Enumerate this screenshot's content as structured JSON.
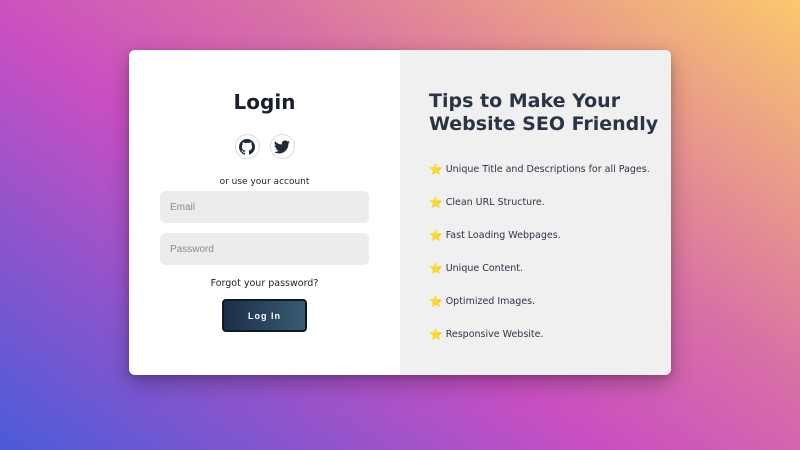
{
  "login": {
    "title": "Login",
    "or_text": "or use your account",
    "email_placeholder": "Email",
    "password_placeholder": "Password",
    "forgot_link": "Forgot your password?",
    "submit_label": "Log In",
    "socials": [
      {
        "icon": "github-icon"
      },
      {
        "icon": "twitter-icon"
      }
    ]
  },
  "tips": {
    "title": "Tips to Make Your Website SEO Friendly",
    "star": "⭐",
    "items": [
      "Unique Title and Descriptions for all Pages.",
      "Clean URL Structure.",
      "Fast Loading Webpages.",
      "Unique Content.",
      "Optimized Images.",
      "Responsive Website."
    ]
  },
  "colors": {
    "button_dark": "#1a3047",
    "button_light": "#3a5a73",
    "panel_bg": "#f0f0f0",
    "text_dark": "#2b3445"
  }
}
